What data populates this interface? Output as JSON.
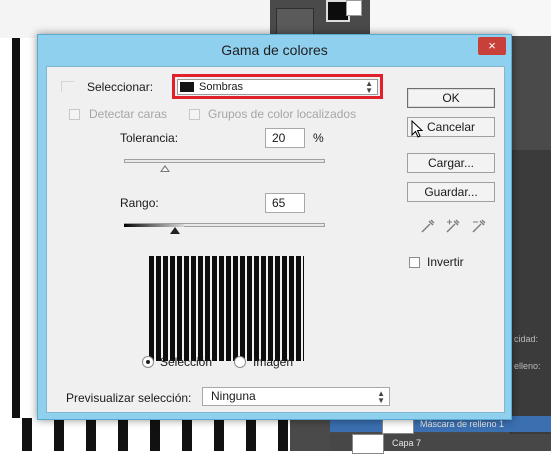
{
  "dialog": {
    "title": "Gama de colores",
    "close_glyph": "×"
  },
  "select": {
    "label": "Seleccionar:",
    "value": "Sombras",
    "swatch_color": "#141414"
  },
  "options": {
    "detect_faces": "Detectar caras",
    "localized_groups": "Grupos de color localizados"
  },
  "tolerance": {
    "label": "Tolerancia:",
    "value": "20",
    "unit": "%"
  },
  "range": {
    "label": "Rango:",
    "value": "65"
  },
  "view": {
    "selection": "Selección",
    "image": "Imagen",
    "selected": "selection"
  },
  "buttons": {
    "ok": "OK",
    "cancel": "Cancelar",
    "load": "Cargar...",
    "save": "Guardar..."
  },
  "invert": {
    "label": "Invertir",
    "checked": false
  },
  "preview": {
    "label": "Previsualizar selección:",
    "value": "Ninguna"
  },
  "background": {
    "layer_1": "Máscara de relleno 1",
    "layer_2": "Capa 7",
    "side_label_1": "cidad:",
    "side_label_2": "elleno:"
  },
  "colors": {
    "title_bar": "#8fd0ef",
    "close_button": "#c9403a",
    "highlight": "#e0202a"
  }
}
